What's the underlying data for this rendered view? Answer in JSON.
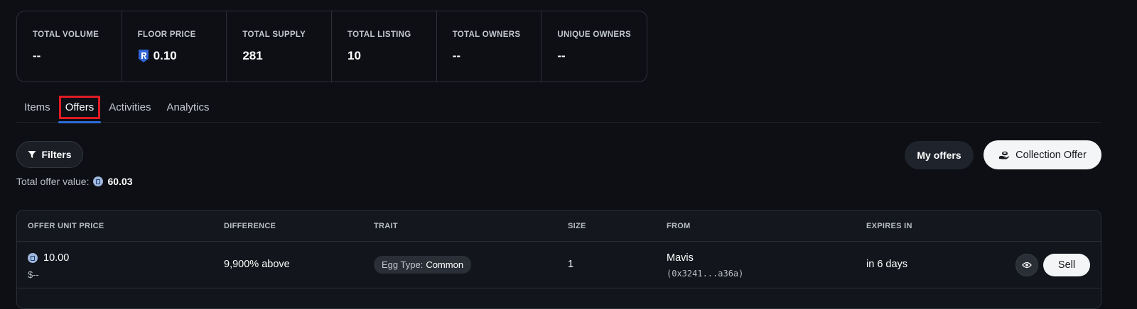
{
  "stats": [
    {
      "label": "TOTAL VOLUME",
      "value": "--",
      "icon": null
    },
    {
      "label": "FLOOR PRICE",
      "value": "0.10",
      "icon": "ron-shield-icon"
    },
    {
      "label": "TOTAL SUPPLY",
      "value": "281",
      "icon": null
    },
    {
      "label": "TOTAL LISTING",
      "value": "10",
      "icon": null
    },
    {
      "label": "TOTAL OWNERS",
      "value": "--",
      "icon": null
    },
    {
      "label": "UNIQUE OWNERS",
      "value": "--",
      "icon": null
    }
  ],
  "tabs": [
    {
      "label": "Items",
      "active": false
    },
    {
      "label": "Offers",
      "active": true
    },
    {
      "label": "Activities",
      "active": false
    },
    {
      "label": "Analytics",
      "active": false
    }
  ],
  "toolbar": {
    "filters_label": "Filters",
    "my_offers_label": "My offers",
    "collection_offer_label": "Collection Offer"
  },
  "summary": {
    "total_offer_label": "Total offer value:",
    "total_offer_value": "60.03"
  },
  "table": {
    "headers": [
      "OFFER UNIT PRICE",
      "DIFFERENCE",
      "TRAIT",
      "SIZE",
      "FROM",
      "EXPIRES IN"
    ],
    "rows": [
      {
        "price": "10.00",
        "price_usd": "$--",
        "difference": "9,900% above",
        "trait_key": "Egg Type:",
        "trait_value": "Common",
        "size": "1",
        "from_name": "Mavis",
        "from_address": "(0x3241...a36a)",
        "expires": "in 6 days",
        "action_label": "Sell"
      }
    ]
  },
  "colors": {
    "background": "#0d0f14",
    "accent_tab": "#2e6bd8",
    "highlight_box": "#e01b24",
    "ron_blue": "#2f63d6"
  }
}
